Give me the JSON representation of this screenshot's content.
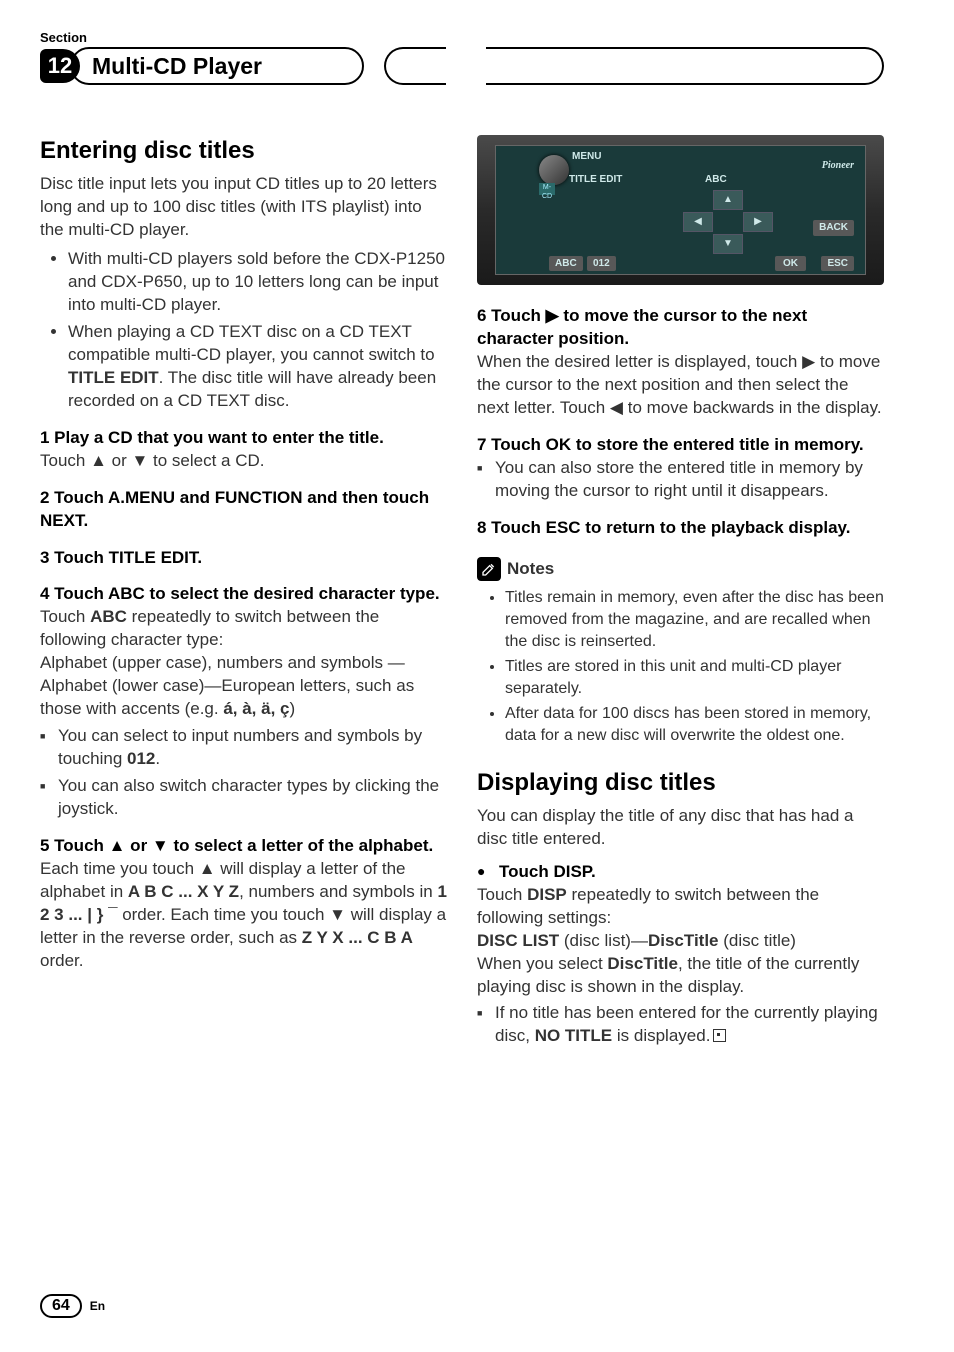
{
  "header": {
    "section_label": "Section",
    "section_number": "12",
    "title": "Multi-CD Player"
  },
  "left": {
    "h2": "Entering disc titles",
    "intro": "Disc title input lets you input CD titles up to 20 letters long and up to 100 disc titles (with ITS playlist) into the multi-CD player.",
    "bullets": [
      "With multi-CD players sold before the CDX-P1250 and CDX-P650, up to 10 letters long can be input into multi-CD player.",
      "When playing a CD TEXT disc on a CD TEXT compatible multi-CD player, you cannot switch to TITLE EDIT. The disc title will have already been recorded on a CD TEXT disc."
    ],
    "s1_head": "1    Play a CD that you want to enter the title.",
    "s1_body": "Touch ▲ or ▼ to select a CD.",
    "s2_head": "2    Touch A.MENU and FUNCTION and then touch NEXT.",
    "s3_head": "3    Touch TITLE EDIT.",
    "s4_head": "4    Touch ABC to select the desired character type.",
    "s4_body": "Touch ABC repeatedly to switch between the following character type:\nAlphabet (upper case), numbers and symbols —Alphabet (lower case)—European letters, such as those with accents (e.g. á, à, ä, ç)",
    "s4_sub1": "You can select to input numbers and symbols by touching 012.",
    "s4_sub2": "You can also switch character types by clicking the joystick.",
    "s5_head": "5    Touch ▲ or ▼ to select a letter of the alphabet.",
    "s5_body": "Each time you touch ▲ will display a letter of the alphabet in A B C ... X Y Z, numbers and symbols in 1 2 3 ... | } ¯ order. Each time you touch ▼ will display a letter in the reverse order, such as Z Y X ... C B A order."
  },
  "device": {
    "menu": "MENU",
    "title_edit": "TITLE EDIT",
    "abc_label": "ABC",
    "back": "BACK",
    "pioneer": "Pioneer",
    "ok": "OK",
    "esc": "ESC",
    "abc_btn": "ABC",
    "n012": "012",
    "mcd": "M-CD"
  },
  "right": {
    "s6_head": "6    Touch ▶ to move the cursor to the next character position.",
    "s6_body": "When the desired letter is displayed, touch ▶ to move the cursor to the next position and then select the next letter. Touch ◀ to move backwards in the display.",
    "s7_head": "7    Touch OK to store the entered title in memory.",
    "s7_sub": "You can also store the entered title in memory by moving the cursor to right until it disappears.",
    "s8_head": "8    Touch ESC to return to the playback display.",
    "notes_label": "Notes",
    "notes": [
      "Titles remain in memory, even after the disc has been removed from the magazine, and are recalled when the disc is reinserted.",
      "Titles are stored in this unit and multi-CD player separately.",
      "After data for 100 discs has been stored in memory, data for a new disc will overwrite the oldest one."
    ],
    "h2b": "Displaying disc titles",
    "disp_intro": "You can display the title of any disc that has had a disc title entered.",
    "disp_head": "Touch DISP.",
    "disp_body": "Touch DISP repeatedly to switch between the following settings:\nDISC LIST (disc list)—DiscTitle (disc title)\nWhen you select DiscTitle, the title of the currently playing disc is shown in the display.",
    "disp_sub": "If no title has been entered for the currently playing disc, NO TITLE is displayed."
  },
  "footer": {
    "page": "64",
    "lang": "En"
  }
}
